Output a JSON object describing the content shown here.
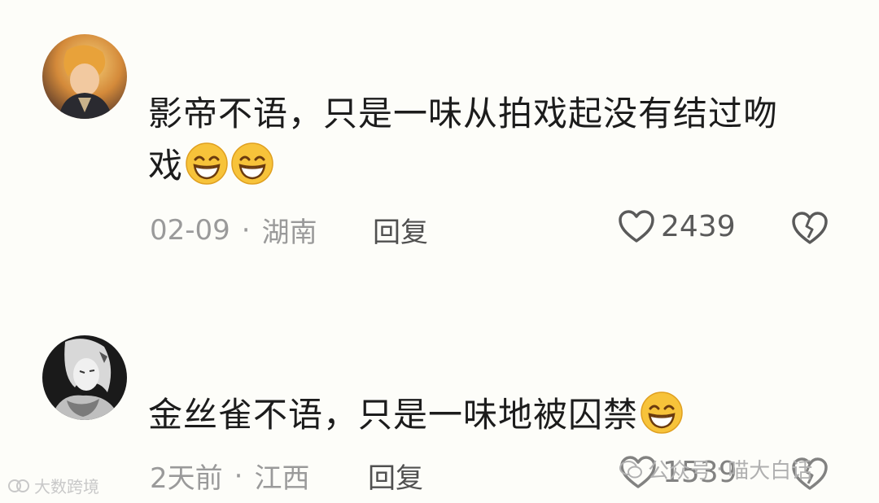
{
  "comments": [
    {
      "text_line1": "影帝不语，只是一味从拍戏起没有结过吻",
      "text_line2": "戏",
      "emoji": "grinning-emoji",
      "date": "02-09",
      "separator": "·",
      "location": "湖南",
      "reply_label": "回复",
      "likes": "2439"
    },
    {
      "text_line1": "金丝雀不语，只是一味地被囚禁",
      "emoji": "grinning-emoji",
      "date": "2天前",
      "separator": "·",
      "location": "江西",
      "reply_label": "回复",
      "likes": "1539"
    }
  ],
  "watermarks": {
    "left": "大数跨境",
    "right_account": "公众号",
    "right_separator": "·",
    "right_name": "喵大白话"
  },
  "colors": {
    "background": "#fdfdf9",
    "text": "#1c1c1c",
    "meta": "#9a9a9a",
    "emoji_face": "#f7c33a"
  }
}
